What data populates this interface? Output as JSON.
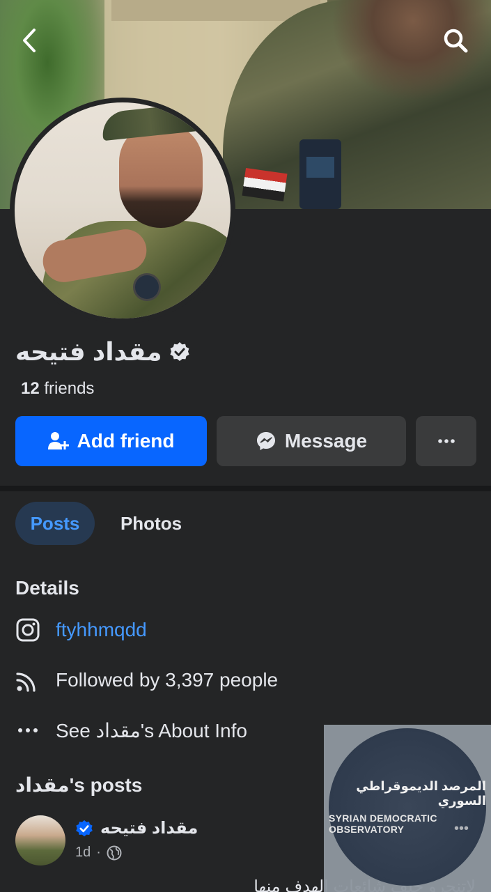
{
  "header": {
    "back_icon": "chevron-left-icon",
    "search_icon": "search-icon"
  },
  "profile": {
    "name": "مقداد فتيحه",
    "verified_icon": "verified-badge-icon",
    "friends_count": "12",
    "friends_label": "friends"
  },
  "actions": {
    "add_friend": "Add friend",
    "message": "Message",
    "more_icon": "more-dots-icon",
    "accent": "#0866ff"
  },
  "tabs": [
    {
      "label": "Posts",
      "active": true
    },
    {
      "label": "Photos",
      "active": false
    }
  ],
  "details": {
    "title": "Details",
    "instagram": "ftyhhmqdd",
    "followed_by": "Followed by 3,397 people",
    "about": "See مقداد's About Info"
  },
  "posts": {
    "title": "مقداد's posts",
    "author": "مقداد فتيحه",
    "time": "1d",
    "separator": "·",
    "text": "لاتنجرو خلف شائعات الهدف منها"
  },
  "watermark": {
    "arabic": "المرصد الديموقراطي السوري",
    "english": "SYRIAN DEMOCRATIC OBSERVATORY",
    "dots": "•••"
  }
}
